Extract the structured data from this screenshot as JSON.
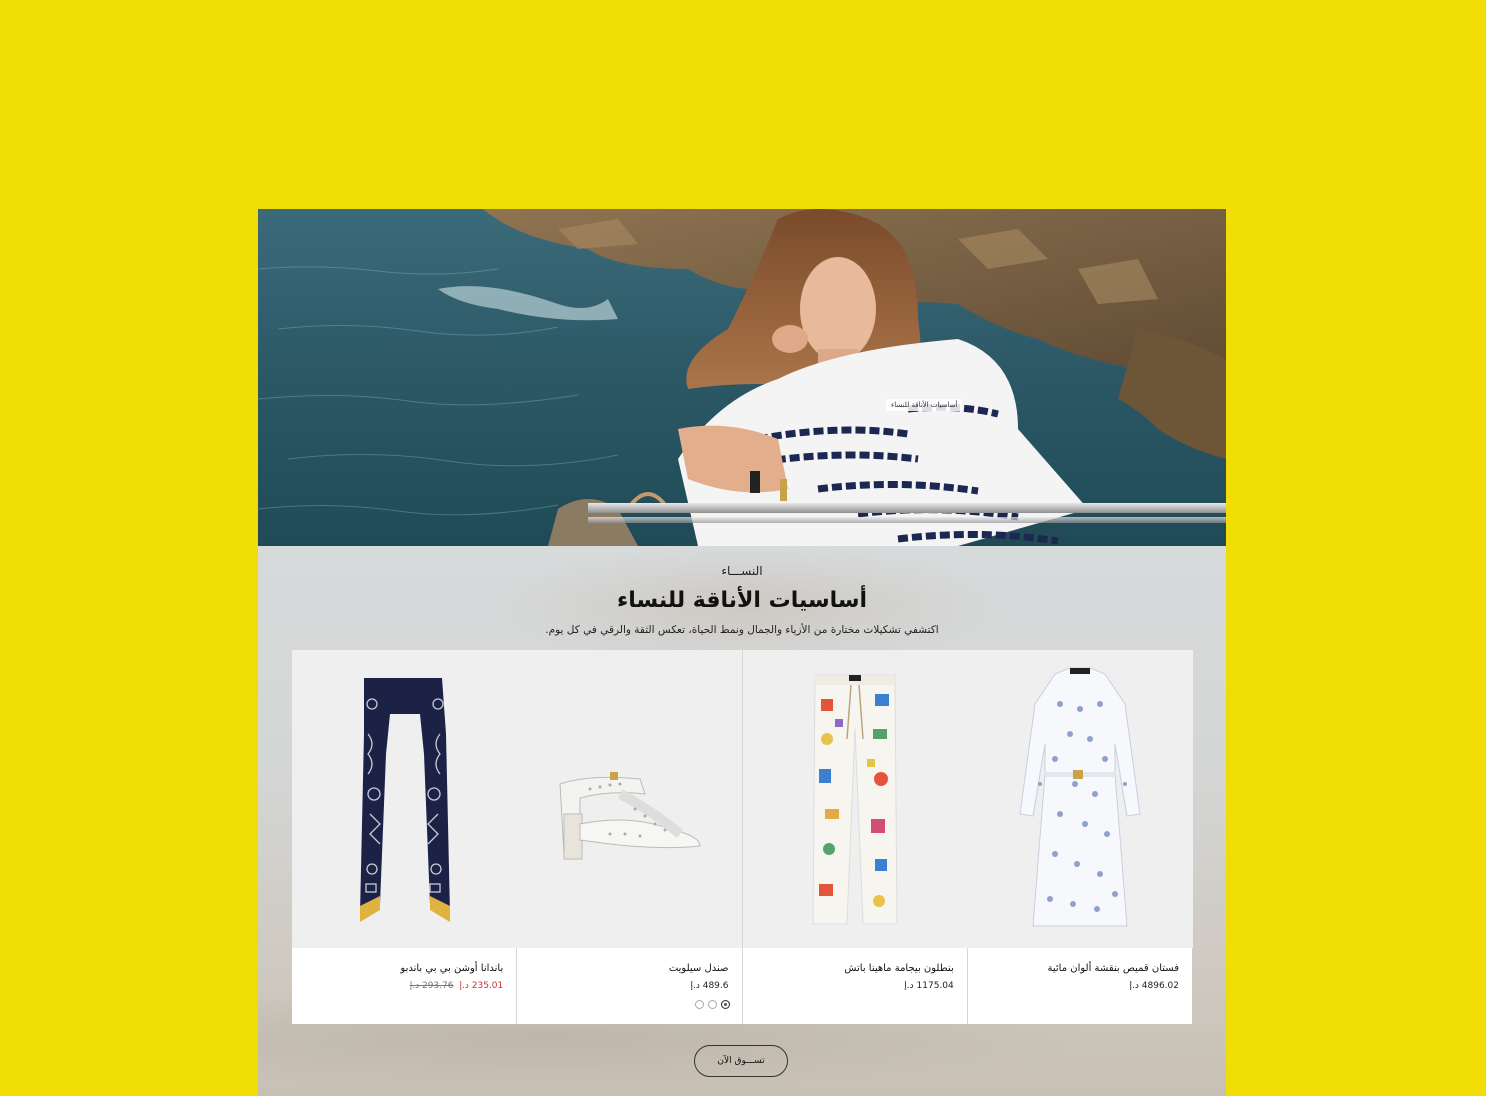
{
  "hero": {
    "image": "woman-in-striped-top-by-sea",
    "tag": "أساسيات الأناقة للنساء"
  },
  "section": {
    "eyebrow": "النســـاء",
    "title": "أساسيات الأناقة للنساء",
    "subtitle": "اكتشفي تشكيلات مختارة من الأزياء والجمال ونمط الحياة، تعكس الثقة والرقي في كل يوم."
  },
  "products": [
    {
      "name": "فستان قميص بنقشة ألوان مائية",
      "price": "4896.02 د.إ",
      "image": "monogram-shirt-dress"
    },
    {
      "name": "بنطلون بيجامة ماهينا باتش",
      "price": "1175.04 د.إ",
      "image": "patch-print-pajama-pants"
    },
    {
      "name": "صندل سيلويت",
      "price": "489.6 د.إ",
      "image": "white-perforated-sandal",
      "swatches": 3
    },
    {
      "name": "باندانا أوشن بي بي باندبو",
      "sale_price": "235.01 د.إ",
      "old_price": "293.76 د.إ",
      "image": "navy-silk-bandeau"
    }
  ],
  "cta": {
    "label": "تســـوق الآن"
  },
  "colors": {
    "background": "#f1dd06",
    "sale": "#d32f2f"
  }
}
